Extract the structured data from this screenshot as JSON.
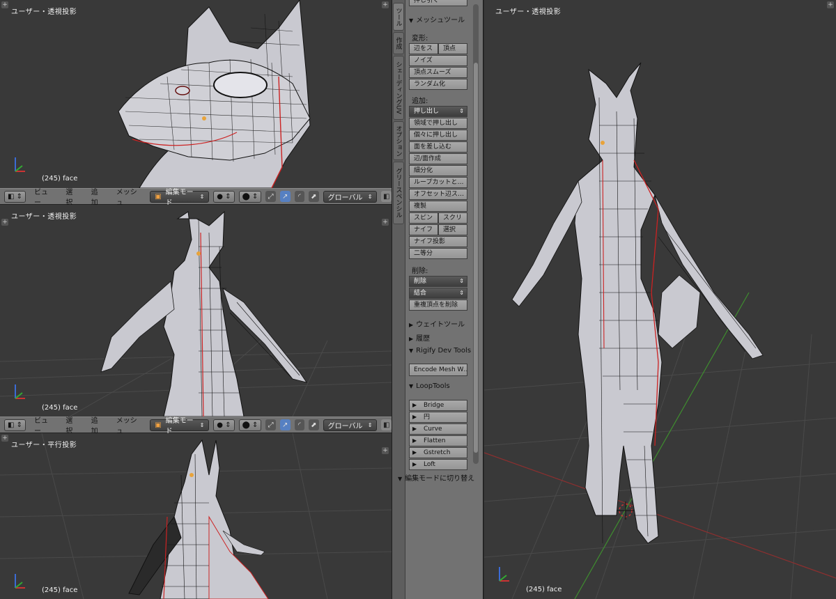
{
  "viewports": {
    "top_left": {
      "title": "ユーザー・透視投影",
      "status": "(245) face"
    },
    "mid_left": {
      "title": "ユーザー・透視投影",
      "status": "(245) face"
    },
    "bot_left": {
      "title": "ユーザー・平行投影",
      "status": "(245) face"
    },
    "right": {
      "title": "ユーザー・透視投影",
      "status": "(245) face"
    }
  },
  "header": {
    "view": "ビュー",
    "select": "選択",
    "add": "追加",
    "mesh": "メッシュ",
    "mode": "編集モード",
    "orientation": "グローバル"
  },
  "tool_tabs": [
    "ツール",
    "作成",
    "シェーディングUV",
    "オプション",
    "グリースペンシル"
  ],
  "tool_panel": {
    "top_cut": "押し引く",
    "mesh_tools": "メッシュツール",
    "deform_label": "変形:",
    "deform": {
      "slide_edge": "辺をス",
      "vertex": "頂点",
      "noise": "ノイズ",
      "smooth_vertex": "頂点スムーズ",
      "randomize": "ランダム化"
    },
    "add_label": "追加:",
    "add": {
      "extrude": "押し出し",
      "extrude_region": "領域で押し出し",
      "extrude_individual": "個々に押し出し",
      "inset_faces": "面を差し込む",
      "make_edge_face": "辺/面作成",
      "subdivide": "細分化",
      "loop_cut": "ループカットと…",
      "offset_edge": "オフセット辺ス…",
      "duplicate": "複製",
      "spin": "スピン",
      "screw": "スクリ",
      "knife": "ナイフ",
      "select": "選択",
      "knife_project": "ナイフ投影",
      "bisect": "二等分"
    },
    "delete_label": "削除:",
    "delete": {
      "delete": "削除",
      "dissolve": "結合",
      "remove_doubles": "重複頂点を削除"
    },
    "weight_tools": "ウェイトツール",
    "history": "履歴",
    "rigify": "Rigify Dev Tools",
    "encode": "Encode Mesh W…",
    "looptools": "LoopTools",
    "looptools_items": [
      "Bridge",
      "円",
      "Curve",
      "Flatten",
      "Gstretch",
      "Loft"
    ],
    "toggle_edit": "編集モードに切り替え"
  },
  "colors": {
    "viewport_bg": "#393939",
    "grid": "#4a4a4a",
    "axis_x": "#8e2f2f",
    "axis_y": "#3f8e2f",
    "model": "#c9c9d0",
    "wire": "#111111",
    "seam": "#cc2222",
    "panel": "#727272"
  }
}
